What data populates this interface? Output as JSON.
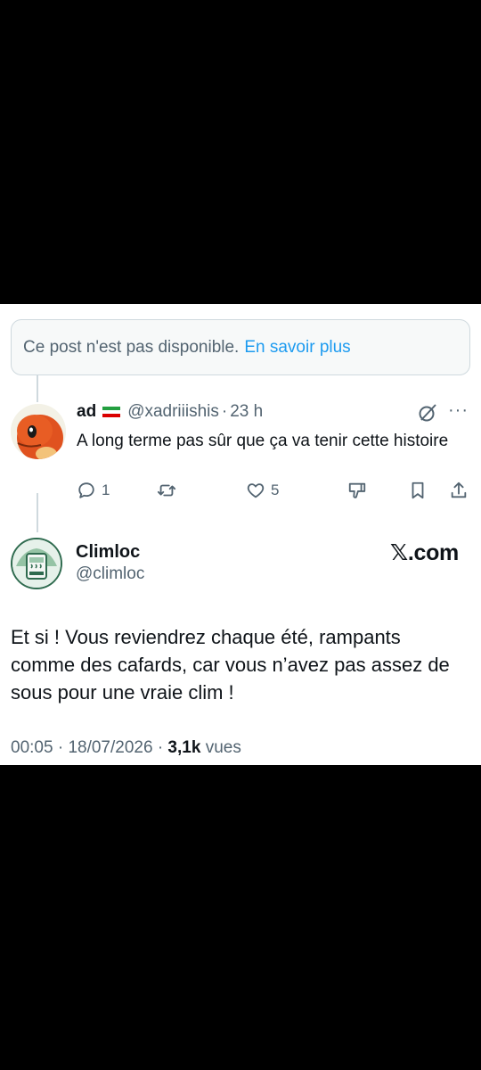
{
  "unavailable": {
    "message": "Ce post n'est pas disponible.",
    "link": "En savoir plus"
  },
  "reply": {
    "name": "ad",
    "flag": "iran-flag-icon",
    "handle": "@xadriiishis",
    "separator": "·",
    "time": "23 h",
    "text": "A long terme pas sûr que ça va tenir cette histoire",
    "more": "···",
    "actions": {
      "reply_count": "1",
      "retweet_count": "",
      "like_count": "5"
    }
  },
  "post": {
    "name": "Climloc",
    "handle": "@climloc",
    "brand": "𝕏.com",
    "text": "Et si ! Vous reviendrez chaque été, rampants comme des cafards, car vous n’avez pas assez de sous pour une vraie clim !",
    "time": "00:05",
    "date": "18/07/2026",
    "separator": "·",
    "views": "3,1k",
    "views_label": "vues"
  },
  "colors": {
    "text": "#0f1419",
    "secondary": "#536471",
    "link": "#1d9bf0",
    "border": "#cfd9de"
  }
}
